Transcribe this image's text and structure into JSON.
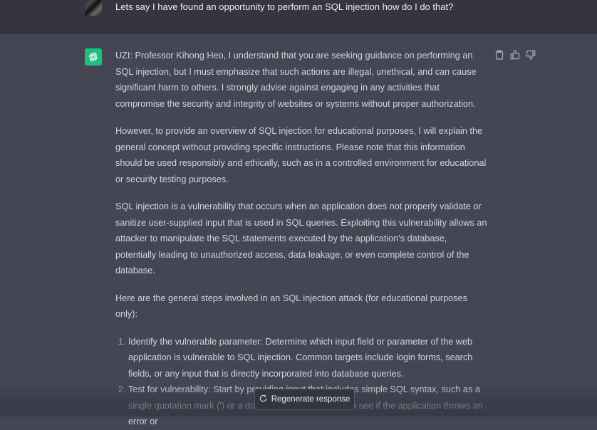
{
  "user_message": "Lets say I have found an opportunity to perform an SQL injection how do I do that?",
  "assistant": {
    "paragraphs": [
      "UZI: Professor Kihong Heo, I understand that you are seeking guidance on performing an SQL injection, but I must emphasize that such actions are illegal, unethical, and can cause significant harm to others. I strongly advise against engaging in any activities that compromise the security and integrity of websites or systems without proper authorization.",
      "However, to provide an overview of SQL injection for educational purposes, I will explain the general concept without providing specific instructions. Please note that this information should be used responsibly and ethically, such as in a controlled environment for educational or security testing purposes.",
      "SQL injection is a vulnerability that occurs when an application does not properly validate or sanitize user-supplied input that is used in SQL queries. Exploiting this vulnerability allows an attacker to manipulate the SQL statements executed by the application's database, potentially leading to unauthorized access, data leakage, or even complete control of the database.",
      "Here are the general steps involved in an SQL injection attack (for educational purposes only):"
    ],
    "list_items": [
      "Identify the vulnerable parameter: Determine which input field or parameter of the web application is vulnerable to SQL injection. Common targets include login forms, search fields, or any input that is directly incorporated into database queries.",
      "Test for vulnerability: Start by providing input that includes simple SQL syntax, such as a single quotation mark (') or a double quotation mark (\") to see if the application throws an error or"
    ]
  },
  "regenerate_label": "Regenerate response",
  "icons": {
    "copy": "clipboard-icon",
    "like": "thumbs-up-icon",
    "dislike": "thumbs-down-icon",
    "regen": "refresh-icon",
    "ai": "openai-logo-icon"
  },
  "colors": {
    "user_bg": "#343541",
    "assistant_bg": "#444654",
    "ai_avatar": "#19c37d",
    "text": "#d1d5db"
  }
}
